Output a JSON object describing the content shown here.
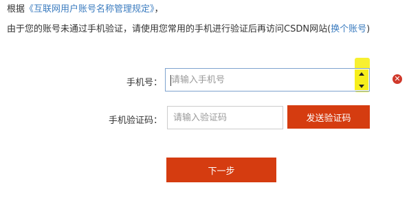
{
  "notice": {
    "line1_prefix": "根据",
    "rules_link": "《互联网用户账号名称管理规定》",
    "line1_suffix": "，",
    "line2_text": "由于您的账号未通过手机验证，请使用您常用的手机进行验证后再访问CSDN网站(",
    "switch_account_link": "换个账号",
    "line2_suffix": ")"
  },
  "form": {
    "phone_label": "手机号：",
    "phone_placeholder": "请输入手机号",
    "code_label": "手机验证码：",
    "code_placeholder": "请输入验证码",
    "send_code_label": "发送验证码",
    "next_label": "下一步"
  },
  "icons": {
    "clear": "close-circle-icon",
    "spinner_up": "spinner-up-icon",
    "spinner_down": "spinner-down-icon"
  },
  "colors": {
    "link": "#3a7bbf",
    "button": "#d53c10",
    "highlight": "#f6ee1b",
    "clear_icon": "#d0392b"
  }
}
